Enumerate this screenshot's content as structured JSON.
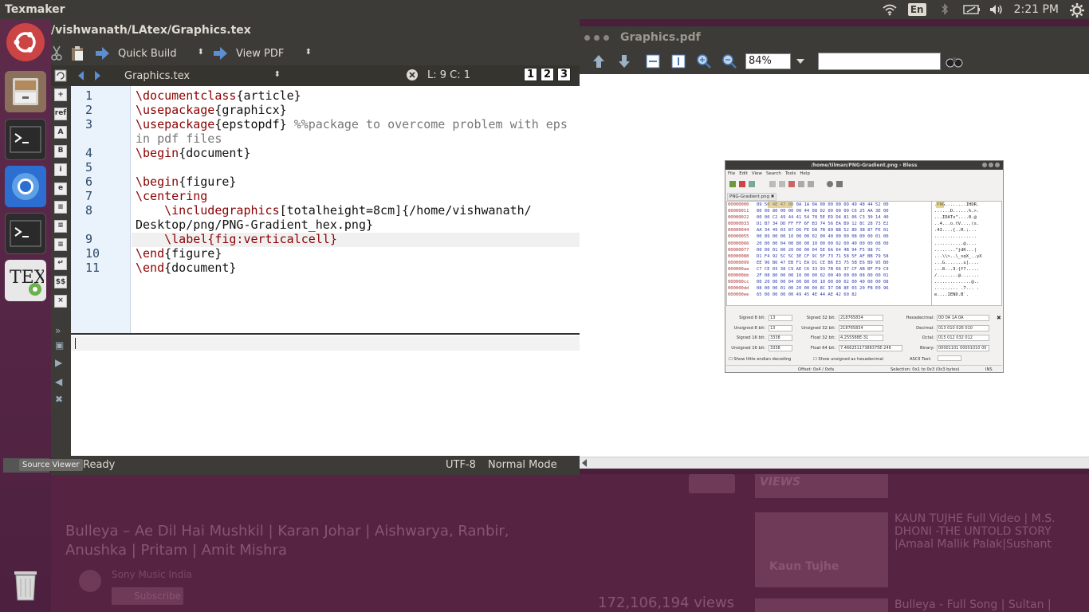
{
  "topbar": {
    "app_name": "Texmaker",
    "lang": "En",
    "time": "2:21 PM"
  },
  "editor": {
    "title": "/vishwanath/LAtex/Graphics.tex",
    "toolbar": {
      "quick_build": "Quick Build",
      "view_pdf": "View PDF"
    },
    "file_tab": "Graphics.tex",
    "cursor_pos": "L: 9 C: 1",
    "view_buttons": [
      "1",
      "2",
      "3"
    ],
    "leftbar": [
      "+",
      "ref",
      "A",
      "B",
      "i",
      "e",
      "≡",
      "≡",
      "≡",
      "↵",
      "$$",
      "×"
    ],
    "lines": [
      {
        "num": "1",
        "segs": [
          [
            "cmd",
            "\\documentclass"
          ],
          [
            "arg",
            "{article}"
          ]
        ]
      },
      {
        "num": "2",
        "segs": [
          [
            "cmd",
            "\\usepackage"
          ],
          [
            "arg",
            "{graphicx}"
          ]
        ]
      },
      {
        "num": "3",
        "segs": [
          [
            "cmd",
            "\\usepackage"
          ],
          [
            "arg",
            "{epstopdf} "
          ],
          [
            "cmt",
            "%%package to overcome problem with eps"
          ]
        ]
      },
      {
        "num": "",
        "segs": [
          [
            "cmt",
            "in pdf files"
          ]
        ]
      },
      {
        "num": "4",
        "segs": [
          [
            "cmd",
            "\\begin"
          ],
          [
            "arg",
            "{document}"
          ]
        ]
      },
      {
        "num": "5",
        "segs": []
      },
      {
        "num": "6",
        "segs": [
          [
            "cmd",
            "\\begin"
          ],
          [
            "arg",
            "{figure}"
          ]
        ]
      },
      {
        "num": "7",
        "segs": [
          [
            "cmd",
            "\\centering"
          ]
        ]
      },
      {
        "num": "8",
        "segs": [
          [
            "arg",
            "\t"
          ],
          [
            "cmd",
            "\\includegraphics"
          ],
          [
            "arg",
            "[totalheight=8cm]{/home/vishwanath/"
          ]
        ]
      },
      {
        "num": "",
        "segs": [
          [
            "arg",
            "Desktop/png/PNG-Gradient_hex.png}"
          ]
        ]
      },
      {
        "num": "9",
        "segs": [
          [
            "arg",
            "\t"
          ],
          [
            "cmd",
            "\\label{fig:verticalcell}"
          ]
        ]
      },
      {
        "num": "10",
        "segs": [
          [
            "cmd",
            "\\end"
          ],
          [
            "arg",
            "{figure}"
          ]
        ]
      },
      {
        "num": "11",
        "segs": [
          [
            "cmd",
            "\\end"
          ],
          [
            "arg",
            "{document}"
          ]
        ]
      }
    ],
    "status": {
      "source_viewer": "Source Viewer",
      "ready": "Ready",
      "encoding": "UTF-8",
      "mode": "Normal Mode"
    }
  },
  "pdf": {
    "title": "Graphics.pdf",
    "zoom": "84%",
    "search_placeholder": "",
    "bless": {
      "title": "/home/tilman/PNG-Gradient.png - Bless",
      "menus": [
        "File",
        "Edit",
        "View",
        "Search",
        "Tools",
        "Help"
      ],
      "tab": "PNG-Gradient.png",
      "offsets": [
        "00000000",
        "00000011",
        "00000022",
        "00000033",
        "00000044",
        "00000055",
        "00000066",
        "00000077",
        "00000088",
        "00000099",
        "000000aa",
        "000000bb",
        "000000cc",
        "000000dd",
        "000000ee"
      ],
      "hex": [
        "89 50 4E 47 0D 0A 1A 0A 00 00 00 0D 49 48 44 52 00",
        "00 00 80 00 00 00 44 08 02 00 00 00 C6 25 AA 3E 00",
        "00 00 C2 49 44 41 54 78 5E ED D4 81 06 C3 30 14 40",
        "D1 B7 34 DD FF FF 6F B3 74 56 EA B9 12 8C 28 73 E2",
        "AA 34 49 03 87 D6 FE D8 7B 89 BB 52 8D 3B 87 FE 01",
        "00 89 00 00 10 00 00 02 00 40 00 00 08 00 00 01 00",
        "20 00 00 04 00 80 00 10 00 00 02 00 40 00 00 08 00",
        "00 00 01 00 20 00 00 04 5E 6A 64 4B 94 F5 98 7C",
        "D1 F4 92 5C 5C 3E CF 9C 5F 73 71 58 5F AF BB 79 58",
        "EE 96 B6 47 EB F1 EA D1 CE B6 E3 75 5B E6 B9 95 B0",
        "C7 CE 03 38 C9 AE C6 33 93 7B 66 37 CF AB BF F9 C9",
        "2F 08 80 00 00 10 00 00 02 00 40 00 00 08 00 00 01",
        "00 20 00 00 04 00 80 00 10 00 00 02 00 40 00 00 08",
        "08 00 00 01 00 20 00 00 8C 37 DB 8E 03 20 FB E0 96",
        "65 00 00 00 00 49 45 4E 44 AE 42 60 82"
      ],
      "ascii": [
        ".PNG........IHDR.",
        "......D......%.>.",
        "...IDATx^....0.@",
        "..4...o.tV....(s.",
        ".4I....{..R.;...",
        "................",
        "...........@....",
        "........^jdK...|",
        "...\\\\>..\\_sqX_..yX",
        "...G.......u[....",
        "...8...3.{f7.....",
        "/........@.......",
        "..............@..",
        "......... .7... .",
        "e....IEND.B`."
      ],
      "fields": [
        {
          "label": "Signed 8 bit:",
          "value": "13"
        },
        {
          "label": "Signed 32 bit:",
          "value": "218765834"
        },
        {
          "label": "Hexadecimal:",
          "value": "0D 0A 1A 0A"
        },
        {
          "label": "Unsigned 8 bit:",
          "value": "13"
        },
        {
          "label": "Unsigned 32 bit:",
          "value": "218765834"
        },
        {
          "label": "Decimal:",
          "value": "013 010 026 010"
        },
        {
          "label": "Signed 16 bit:",
          "value": "3338"
        },
        {
          "label": "Float 32 bit:",
          "value": "4.255588E-31"
        },
        {
          "label": "Octal:",
          "value": "015 012 032 012"
        },
        {
          "label": "Unsigned 16 bit:",
          "value": "3338"
        },
        {
          "label": "Float 64 bit:",
          "value": "7.46625117388375E-246"
        },
        {
          "label": "Binary:",
          "value": "00001101 00001010 00"
        }
      ],
      "ascii_text_label": "ASCII Text:",
      "check1": "Show little endian decoding",
      "check2": "Show unsigned as hexadecimal",
      "offset_status": "Offset: 0x4 / 0xfa",
      "selection_status": "Selection: 0x1 to 0x3 (0x3 bytes)",
      "ins": "INS"
    }
  },
  "background": {
    "video_title_1": "Bulleya – Ae Dil Hai Mushkil | Karan Johar | Aishwarya, Ranbir,",
    "video_title_2": "Anushka | Pritam | Amit Mishra",
    "channel": "Sony Music India",
    "subscribe": "Subscribe",
    "views": "172,106,194 views",
    "rec1": "KAUN TUJHE Full Video | M.S.",
    "rec2": "DHONI -THE UNTOLD STORY",
    "rec3": "|Amaal Mallik Palak|Sushant",
    "rec4": "Bulleya - Full Song | Sultan |",
    "thumb_text": "Kaun Tujhe",
    "badge": "VIEWS"
  }
}
